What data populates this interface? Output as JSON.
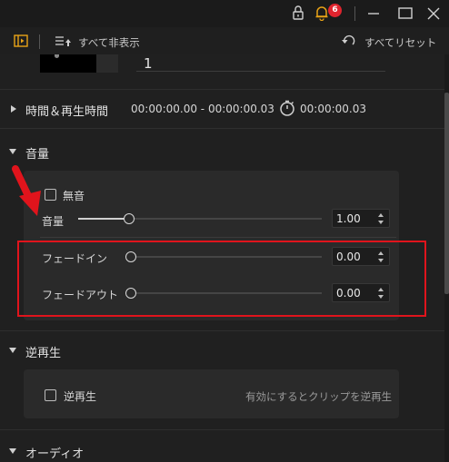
{
  "titlebar": {
    "notification_count": "6",
    "icons": [
      "lock-icon",
      "bell-icon",
      "minimize-icon",
      "maximize-icon",
      "close-icon"
    ]
  },
  "toolbar": {
    "hide_all_label": "すべて非表示",
    "reset_all_label": "すべてリセット"
  },
  "clip": {
    "number_value": "1"
  },
  "time_section": {
    "label": "時間＆再生時間",
    "range_text": "00:00:00.00 - 00:00:00.03",
    "duration_text": "00:00:00.03"
  },
  "volume_section": {
    "label": "音量",
    "mute_label": "無音",
    "volume_label": "音量",
    "volume_value": "1.00",
    "volume_level": 0.21,
    "fade_in_label": "フェードイン",
    "fade_in_value": "0.00",
    "fade_out_label": "フェードアウト",
    "fade_out_value": "0.00"
  },
  "reverse_section": {
    "label": "逆再生",
    "checkbox_label": "逆再生",
    "hint": "有効にするとクリップを逆再生"
  },
  "audio_section": {
    "label": "オーディオ"
  },
  "colors": {
    "background": "#202020",
    "panel": "#2a2a2a",
    "highlight_box": "#e0141c",
    "arrow": "#e0141c",
    "badge": "#e0242e",
    "panel_icon": "#e8a317"
  }
}
